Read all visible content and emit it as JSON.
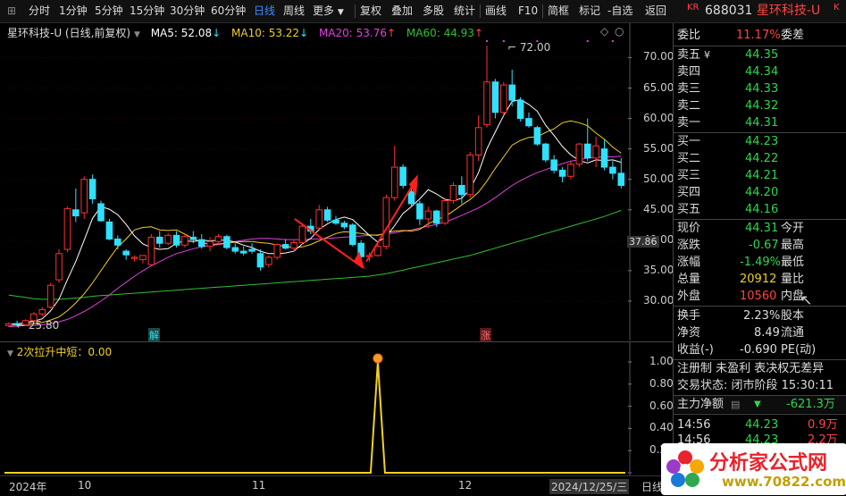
{
  "toolbar": {
    "items": [
      "分时",
      "1分钟",
      "5分钟",
      "15分钟",
      "30分钟",
      "60分钟",
      "日线",
      "周线",
      "更多",
      "复权",
      "叠加",
      "多股",
      "统计",
      "画线",
      "F10",
      "简框",
      "标记",
      "-自选",
      "返回"
    ],
    "active_index": 6
  },
  "stock": {
    "badge": "KR",
    "code": "688031",
    "name": "星环科技-U"
  },
  "main_legend": {
    "title": "星环科技-U (日线,前复权)",
    "ma5": "MA5: 52.08",
    "ma10": "MA10: 53.22",
    "ma20": "MA20: 53.76",
    "ma60": "MA60: 44.93"
  },
  "indicator": {
    "label": "2次拉升中短：0.00"
  },
  "markers": {
    "high": "72.00",
    "low": "25.80",
    "current": "37.86",
    "jie": "解",
    "zhang": "涨"
  },
  "dates": {
    "year": "2024年",
    "m10": "10",
    "m11": "11",
    "m12": "12",
    "last": "2024/12/25/三",
    "period": "日线"
  },
  "colors": {
    "ma5": "#ffffff",
    "ma10": "#f0d020",
    "ma20": "#e040e0",
    "ma60": "#30c030",
    "up": "#ff3030",
    "down": "#30e0ff",
    "accent": "#3a8dff"
  },
  "panel": {
    "weibi": {
      "label": "委比",
      "value": "11.17%",
      "label2": "委差"
    },
    "asks": [
      {
        "label": "卖五",
        "mark": "¥",
        "price": "44.35"
      },
      {
        "label": "卖四",
        "price": "44.34"
      },
      {
        "label": "卖三",
        "price": "44.33"
      },
      {
        "label": "卖二",
        "price": "44.32"
      },
      {
        "label": "卖一",
        "price": "44.31"
      }
    ],
    "bids": [
      {
        "label": "买一",
        "price": "44.23"
      },
      {
        "label": "买二",
        "price": "44.22"
      },
      {
        "label": "买三",
        "price": "44.21"
      },
      {
        "label": "买四",
        "price": "44.20"
      },
      {
        "label": "买五",
        "price": "44.16"
      }
    ],
    "stats": [
      {
        "label": "现价",
        "value": "44.31",
        "label2": "今开"
      },
      {
        "label": "涨跌",
        "value": "-0.67",
        "label2": "最高"
      },
      {
        "label": "涨幅",
        "value": "-1.49%",
        "label2": "最低"
      },
      {
        "label": "总量",
        "value": "20912",
        "label2": "量比"
      },
      {
        "label": "外盘",
        "value": "10560",
        "label2": "内盘"
      }
    ],
    "stats2": [
      {
        "label": "换手",
        "value": "2.23%",
        "label2": "股本"
      },
      {
        "label": "净资",
        "value": "8.49",
        "label2": "流通"
      },
      {
        "label": "收益(-)",
        "value": "-0.690",
        "label2": "PE(动)"
      }
    ],
    "tags": "注册制 未盈利 表决权无差异",
    "trade_status": "交易状态: 闭市阶段 15:30:11",
    "main_flow": {
      "label": "主力净额",
      "value": "-621.3万"
    },
    "ticks": [
      {
        "time": "14:56",
        "price": "44.23",
        "vol": "0.9万"
      },
      {
        "time": "14:56",
        "price": "44.23",
        "vol": "2.2万"
      }
    ]
  },
  "watermark": {
    "text": "分析家公式网",
    "url": "www.70822.com"
  },
  "chart_data": {
    "type": "candlestick",
    "title": "星环科技-U (日线,前复权)",
    "y_ticks": [
      30,
      35,
      40,
      45,
      50,
      55,
      60,
      65,
      70
    ],
    "ylim": [
      25,
      73
    ],
    "x_labels": [
      "2024年",
      "10",
      "11",
      "12",
      "2024/12/25/三"
    ],
    "candles": [
      [
        26.0,
        26.5,
        25.8,
        26.3
      ],
      [
        26.3,
        26.8,
        25.9,
        26.1
      ],
      [
        26.1,
        27.0,
        26.0,
        26.8
      ],
      [
        26.8,
        28.2,
        26.5,
        27.9
      ],
      [
        27.9,
        29.0,
        27.5,
        28.6
      ],
      [
        29.0,
        33.0,
        28.8,
        32.6
      ],
      [
        33.5,
        38.5,
        33.0,
        37.8
      ],
      [
        38.5,
        45.5,
        38.0,
        45.2
      ],
      [
        45.0,
        48.5,
        43.0,
        44.0
      ],
      [
        44.5,
        50.5,
        43.5,
        50.0
      ],
      [
        50.0,
        50.8,
        46.0,
        46.8
      ],
      [
        46.0,
        46.5,
        43.0,
        43.2
      ],
      [
        43.0,
        43.5,
        40.0,
        40.2
      ],
      [
        40.2,
        40.8,
        38.5,
        39.2
      ],
      [
        38.2,
        38.5,
        36.8,
        37.6
      ],
      [
        37.0,
        37.5,
        36.5,
        37.2
      ],
      [
        36.8,
        37.5,
        36.2,
        37.5
      ],
      [
        36.0,
        41.0,
        35.8,
        40.5
      ],
      [
        40.5,
        41.5,
        38.8,
        39.5
      ],
      [
        39.5,
        41.2,
        39.2,
        40.8
      ],
      [
        40.8,
        41.5,
        38.8,
        39.2
      ],
      [
        39.2,
        41.0,
        38.8,
        40.6
      ],
      [
        40.5,
        41.5,
        39.5,
        40.1
      ],
      [
        40.1,
        41.0,
        38.6,
        39.0
      ],
      [
        39.0,
        40.5,
        38.2,
        39.8
      ],
      [
        39.8,
        41.0,
        39.3,
        40.6
      ],
      [
        40.6,
        40.9,
        38.5,
        38.8
      ],
      [
        38.8,
        39.5,
        37.8,
        38.2
      ],
      [
        38.2,
        39.0,
        37.5,
        37.9
      ],
      [
        38.5,
        39.5,
        37.8,
        38.2
      ],
      [
        37.8,
        38.5,
        35.0,
        35.6
      ],
      [
        36.0,
        37.5,
        35.5,
        37.2
      ],
      [
        37.2,
        39.5,
        36.8,
        39.3
      ],
      [
        39.3,
        40.2,
        38.5,
        38.7
      ],
      [
        38.7,
        40.0,
        38.2,
        39.6
      ],
      [
        39.6,
        42.5,
        39.3,
        42.3
      ],
      [
        42.3,
        43.5,
        41.0,
        41.5
      ],
      [
        42.0,
        45.8,
        41.5,
        45.0
      ],
      [
        45.0,
        45.5,
        43.0,
        43.3
      ],
      [
        43.3,
        44.0,
        42.5,
        42.8
      ],
      [
        42.8,
        43.2,
        41.8,
        42.2
      ],
      [
        42.5,
        42.8,
        39.0,
        39.3
      ],
      [
        39.5,
        40.0,
        37.0,
        37.3
      ],
      [
        37.3,
        38.0,
        36.5,
        37.5
      ],
      [
        37.5,
        39.5,
        37.3,
        39.0
      ],
      [
        39.0,
        47.5,
        38.5,
        47.0
      ],
      [
        47.0,
        55.5,
        46.5,
        52.0
      ],
      [
        52.0,
        52.5,
        48.5,
        49.0
      ],
      [
        48.0,
        49.0,
        45.5,
        46.0
      ],
      [
        46.0,
        46.5,
        42.5,
        43.5
      ],
      [
        43.5,
        45.5,
        42.0,
        44.8
      ],
      [
        44.8,
        45.0,
        42.2,
        42.8
      ],
      [
        42.8,
        47.0,
        42.5,
        46.5
      ],
      [
        46.5,
        49.5,
        46.0,
        49.0
      ],
      [
        49.0,
        50.5,
        46.0,
        47.5
      ],
      [
        47.5,
        54.5,
        47.0,
        54.0
      ],
      [
        54.0,
        60.5,
        53.0,
        58.5
      ],
      [
        59.0,
        72.0,
        58.5,
        66.0
      ],
      [
        66.0,
        66.5,
        60.0,
        61.0
      ],
      [
        61.0,
        66.0,
        60.5,
        65.5
      ],
      [
        65.5,
        68.0,
        62.0,
        63.0
      ],
      [
        63.0,
        63.5,
        59.5,
        60.0
      ],
      [
        60.0,
        61.0,
        58.5,
        58.8
      ],
      [
        58.5,
        58.8,
        55.5,
        55.8
      ],
      [
        55.8,
        56.0,
        52.8,
        53.2
      ],
      [
        53.2,
        54.0,
        51.0,
        51.5
      ],
      [
        51.5,
        52.0,
        49.5,
        50.5
      ],
      [
        50.5,
        53.0,
        50.0,
        52.5
      ],
      [
        52.5,
        56.0,
        52.0,
        55.8
      ],
      [
        55.8,
        60.0,
        53.0,
        53.5
      ],
      [
        53.5,
        57.0,
        52.0,
        55.5
      ],
      [
        55.0,
        56.5,
        51.5,
        52.0
      ],
      [
        52.0,
        53.0,
        50.0,
        51.0
      ],
      [
        51.0,
        53.5,
        48.5,
        49.0
      ]
    ],
    "ma5": [
      26.2,
      26.3,
      26.4,
      26.7,
      27.1,
      28.4,
      30.3,
      33.5,
      36.5,
      40.0,
      43.6,
      45.5,
      45.1,
      44.2,
      42.6,
      40.7,
      39.4,
      38.8,
      38.5,
      38.6,
      39.5,
      39.9,
      39.8,
      40.0,
      39.9,
      40.0,
      40.0,
      39.7,
      39.2,
      38.8,
      38.2,
      37.8,
      37.8,
      37.9,
      38.2,
      39.4,
      40.3,
      41.8,
      42.7,
      43.4,
      43.8,
      43.4,
      42.1,
      40.8,
      39.7,
      40.6,
      42.4,
      44.4,
      45.5,
      46.8,
      48.3,
      47.6,
      46.7,
      46.5,
      46.9,
      48.4,
      51.1,
      55.0,
      57.8,
      60.5,
      62.8,
      63.1,
      62.3,
      61.2,
      58.9,
      57.2,
      55.4,
      54.0,
      53.1,
      52.7,
      53.2,
      53.1,
      53.2,
      52.8
    ],
    "ma10": [
      26.0,
      26.1,
      26.2,
      26.3,
      26.5,
      26.9,
      27.4,
      28.4,
      29.7,
      31.2,
      33.0,
      35.0,
      37.0,
      38.9,
      40.2,
      41.7,
      42.1,
      42.2,
      41.7,
      41.6,
      41.7,
      41.0,
      40.3,
      39.6,
      39.3,
      39.4,
      39.5,
      39.7,
      39.8,
      39.8,
      39.6,
      39.5,
      39.2,
      39.0,
      38.8,
      38.9,
      39.3,
      39.9,
      40.5,
      41.1,
      41.4,
      41.3,
      41.1,
      40.9,
      40.8,
      41.2,
      41.5,
      41.6,
      41.5,
      41.8,
      42.7,
      43.4,
      43.9,
      44.8,
      45.8,
      46.7,
      47.9,
      49.7,
      51.8,
      53.7,
      55.6,
      56.4,
      56.9,
      57.0,
      57.7,
      58.3,
      59.3,
      59.6,
      59.3,
      58.8,
      57.6,
      56.6,
      55.3,
      54.3
    ],
    "ma20": [
      25.8,
      25.9,
      26.0,
      26.0,
      26.1,
      26.3,
      26.6,
      27.0,
      27.6,
      28.3,
      29.1,
      30.0,
      31.0,
      32.1,
      33.1,
      34.1,
      35.0,
      35.8,
      36.5,
      37.2,
      37.8,
      38.2,
      38.6,
      38.9,
      39.1,
      39.3,
      39.5,
      39.8,
      40.0,
      40.2,
      40.3,
      40.3,
      40.2,
      40.1,
      40.1,
      40.1,
      40.2,
      40.2,
      40.3,
      40.4,
      40.5,
      40.6,
      40.7,
      40.8,
      40.9,
      41.0,
      41.2,
      41.5,
      41.7,
      42.0,
      42.3,
      42.6,
      43.0,
      43.5,
      44.1,
      44.7,
      45.3,
      46.1,
      47.0,
      48.0,
      49.0,
      49.8,
      50.5,
      51.1,
      51.6,
      52.1,
      52.6,
      53.0,
      53.2,
      53.5,
      53.6,
      53.7,
      53.7,
      53.8
    ],
    "ma60": [
      31.0,
      30.8,
      30.6,
      30.4,
      30.3,
      30.3,
      30.3,
      30.4,
      30.5,
      30.6,
      30.8,
      30.9,
      31.0,
      31.1,
      31.2,
      31.3,
      31.4,
      31.5,
      31.6,
      31.7,
      31.8,
      31.9,
      32.0,
      32.1,
      32.2,
      32.3,
      32.4,
      32.5,
      32.6,
      32.7,
      32.8,
      32.9,
      33.0,
      33.1,
      33.2,
      33.3,
      33.4,
      33.5,
      33.6,
      33.7,
      33.8,
      33.9,
      34.0,
      34.1,
      34.3,
      34.5,
      34.8,
      35.1,
      35.4,
      35.7,
      36.0,
      36.3,
      36.6,
      36.9,
      37.2,
      37.5,
      37.9,
      38.3,
      38.7,
      39.1,
      39.5,
      39.9,
      40.3,
      40.7,
      41.1,
      41.5,
      41.9,
      42.3,
      42.7,
      43.1,
      43.5,
      43.9,
      44.4,
      44.9
    ],
    "indicator_spike_index": 46,
    "indicator_ylim": [
      0,
      1
    ],
    "indicator_ticks": [
      "1.00",
      "0.80",
      "0.60",
      "0.40",
      "0.20",
      "0.00"
    ]
  }
}
